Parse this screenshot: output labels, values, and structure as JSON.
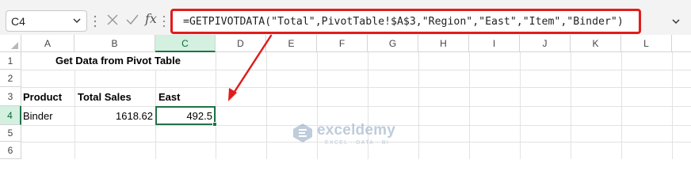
{
  "formula_bar": {
    "name_box": "C4",
    "fx_label": "fx",
    "formula": "=GETPIVOTDATA(\"Total\",PivotTable!$A$3,\"Region\",\"East\",\"Item\",\"Binder\")",
    "highlight_color": "#e11c1c"
  },
  "columns": [
    "A",
    "B",
    "C",
    "D",
    "E",
    "F",
    "G",
    "H",
    "I",
    "J",
    "K",
    "L"
  ],
  "active_column": "C",
  "rows": [
    "1",
    "2",
    "3",
    "4",
    "5",
    "6"
  ],
  "active_row": "4",
  "sheet": {
    "title": "Get Data from Pivot Table",
    "headers": {
      "product": "Product",
      "total_sales": "Total Sales",
      "east": "East"
    },
    "row4": {
      "product": "Binder",
      "total_sales": "1618.62",
      "east": "492.5"
    }
  },
  "watermark": {
    "brand": "exceldemy",
    "tagline": "EXCEL · DATA · BI"
  },
  "accent_color": "#217346"
}
